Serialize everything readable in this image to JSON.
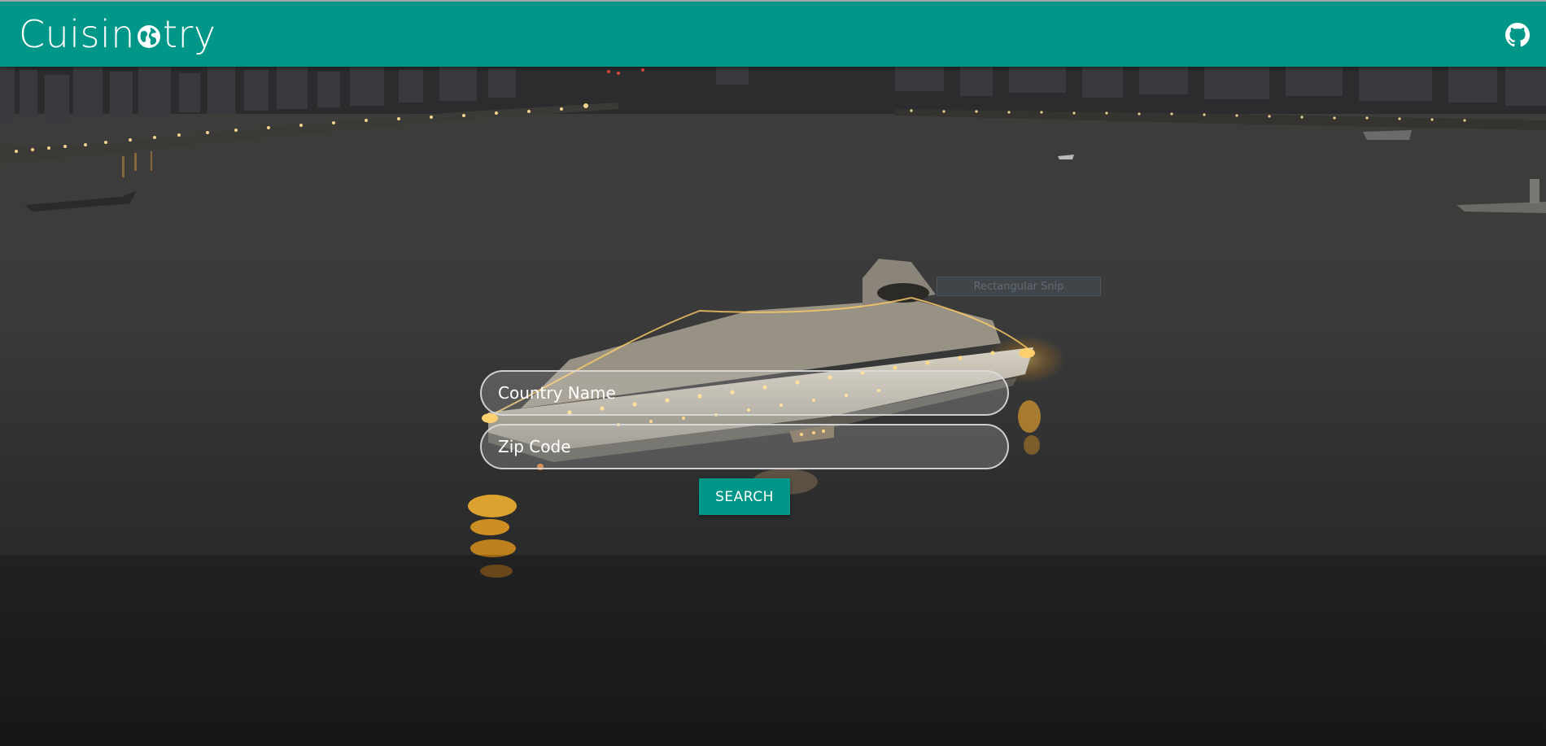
{
  "app": {
    "brand_prefix": "Cuisin",
    "brand_suffix": "try",
    "brand_icon": "globe-icon",
    "github_icon": "github-icon"
  },
  "colors": {
    "primary": "#009688",
    "navbar_text": "#ffffff"
  },
  "search": {
    "country_placeholder": "Country Name",
    "country_value": "",
    "zip_placeholder": "Zip Code",
    "zip_value": "",
    "button_label": "SEARCH"
  },
  "overlay": {
    "snip_tooltip": "Rectangular Snip"
  }
}
